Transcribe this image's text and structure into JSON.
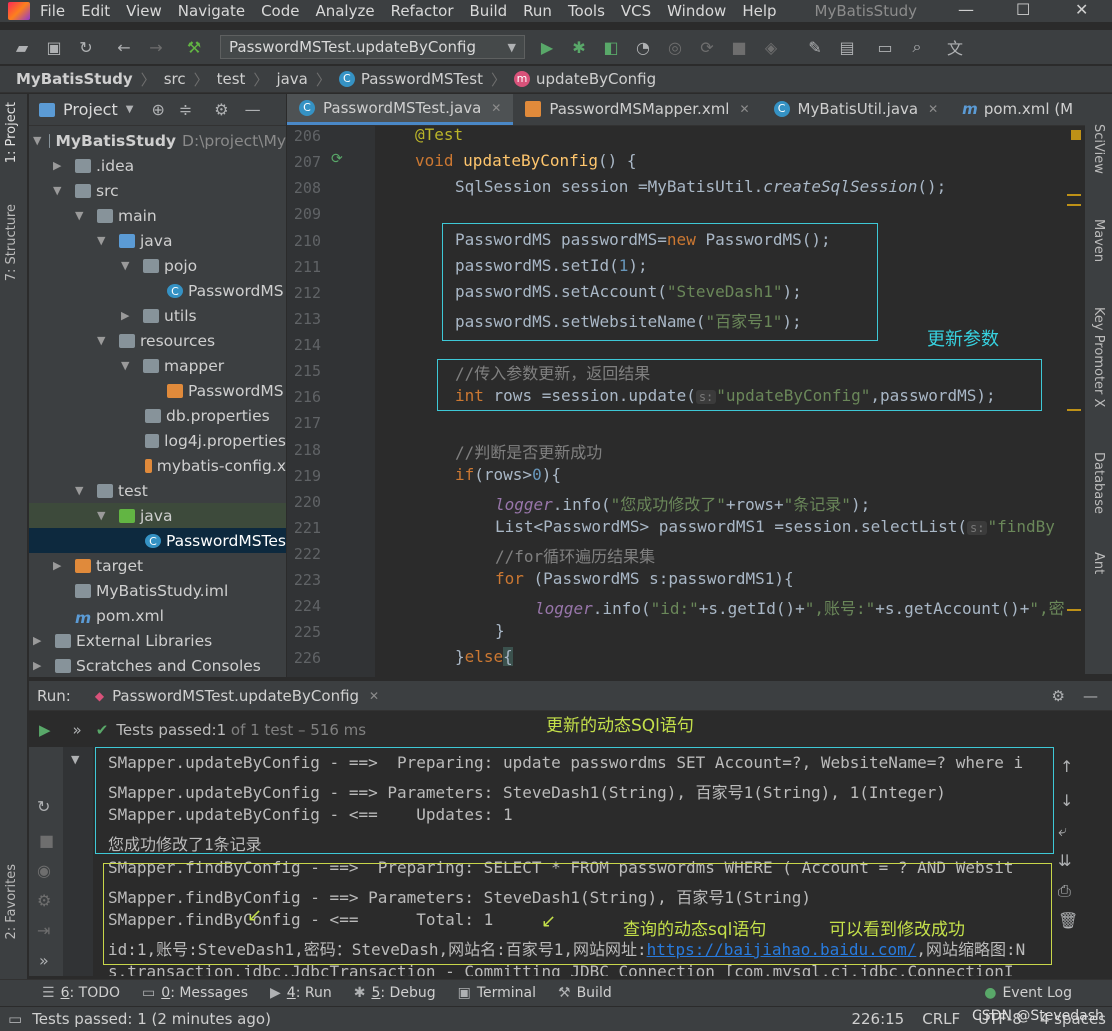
{
  "menubar": {
    "items": [
      "File",
      "Edit",
      "View",
      "Navigate",
      "Code",
      "Analyze",
      "Refactor",
      "Build",
      "Run",
      "Tools",
      "VCS",
      "Window",
      "Help"
    ],
    "title": "MyBatisStudy",
    "minimize": "—",
    "maximize": "☐",
    "close": "✕"
  },
  "toolbar": {
    "run_config": "PasswordMSTest.updateByConfig"
  },
  "breadcrumb": [
    "MyBatisStudy",
    "src",
    "test",
    "java",
    "PasswordMSTest",
    "updateByConfig"
  ],
  "project": {
    "header": "Project",
    "items": [
      {
        "label": "MyBatisStudy",
        "extra": "D:\\project\\My"
      },
      {
        "label": ".idea"
      },
      {
        "label": "src"
      },
      {
        "label": "main"
      },
      {
        "label": "java"
      },
      {
        "label": "pojo"
      },
      {
        "label": "PasswordMS"
      },
      {
        "label": "utils"
      },
      {
        "label": "resources"
      },
      {
        "label": "mapper"
      },
      {
        "label": "PasswordMS"
      },
      {
        "label": "db.properties"
      },
      {
        "label": "log4j.properties"
      },
      {
        "label": "mybatis-config.x"
      },
      {
        "label": "test"
      },
      {
        "label": "java"
      },
      {
        "label": "PasswordMSTes"
      },
      {
        "label": "target"
      },
      {
        "label": "MyBatisStudy.iml"
      },
      {
        "label": "pom.xml"
      },
      {
        "label": "External Libraries"
      },
      {
        "label": "Scratches and Consoles"
      }
    ]
  },
  "tabs": [
    "PasswordMSTest.java",
    "PasswordMSMapper.xml",
    "MyBatisUtil.java",
    "pom.xml (M"
  ],
  "left_strip": [
    "1: Project",
    "7: Structure",
    "2: Favorites"
  ],
  "right_strip": [
    "SciView",
    "Maven",
    "Key Promoter X",
    "Database",
    "Ant"
  ],
  "editor": {
    "line_numbers": [
      "206",
      "207",
      "208",
      "209",
      "210",
      "211",
      "212",
      "213",
      "214",
      "215",
      "216",
      "217",
      "218",
      "219",
      "220",
      "221",
      "222",
      "223",
      "224",
      "225",
      "226"
    ],
    "l206": "@Test",
    "l207_kw": "void ",
    "l207_fn": "updateByConfig",
    "l207_rest": "() {",
    "l208_a": "SqlSession session =MyBatisUtil.",
    "l208_b": "createSqlSession",
    "l208_c": "();",
    "l210_a": "PasswordMS passwordMS=",
    "l210_kw": "new",
    "l210_b": " PasswordMS();",
    "l211_a": "passwordMS.setId(",
    "l211_n": "1",
    "l211_b": ");",
    "l212_a": "passwordMS.setAccount(",
    "l212_s": "\"SteveDash1\"",
    "l212_b": ");",
    "l213_a": "passwordMS.setWebsiteName(",
    "l213_s": "\"百家号1\"",
    "l213_b": ");",
    "l215": "//传入参数更新，返回结果",
    "l216_kw": "int",
    "l216_a": " rows =session.update(",
    "l216_hint": "s:",
    "l216_s": "\"updateByConfig\"",
    "l216_b": ",passwordMS);",
    "l218": "//判断是否更新成功",
    "l219_kw": "if",
    "l219_a": "(rows>",
    "l219_n": "0",
    "l219_b": "){",
    "l220_a": "logger",
    "l220_b": ".info(",
    "l220_s": "\"您成功修改了\"",
    "l220_c": "+rows+",
    "l220_s2": "\"条记录\"",
    "l220_d": ");",
    "l221_a": "List<PasswordMS> passwordMS1 =session.selectList(",
    "l221_hint": "s:",
    "l221_s": "\"findBy",
    "l222": "//for循环遍历结果集",
    "l223_kw": "for",
    "l223_a": " (PasswordMS s:passwordMS1){",
    "l224_a": "logger",
    "l224_b": ".info(",
    "l224_s": "\"id:\"",
    "l224_c": "+s.getId()+",
    "l224_s2": "\",账号:\"",
    "l224_d": "+s.getAccount()+",
    "l224_s3": "\",密",
    "l225": "}",
    "l226_a": "}",
    "l226_kw": "else",
    "l226_b": "{"
  },
  "annotations": {
    "update_params": "更新参数",
    "updated_sql": "更新的动态SQl语句",
    "query_sql": "查询的动态sql语句",
    "success": "可以看到修改成功"
  },
  "run": {
    "label": "Run:",
    "tab": "PasswordMSTest.updateByConfig",
    "tests_passed_a": "Tests passed: ",
    "tests_passed_b": "1",
    "tests_passed_c": " of 1 test – 516 ms",
    "lines": [
      "SMapper.updateByConfig - ==>  Preparing: update passwordms SET Account=?, WebsiteName=? where i",
      "SMapper.updateByConfig - ==> Parameters: SteveDash1(String), 百家号1(String), 1(Integer)",
      "SMapper.updateByConfig - <==    Updates: 1",
      "您成功修改了1条记录",
      "SMapper.findByConfig - ==>  Preparing: SELECT * FROM passwordms WHERE ( Account = ? AND Websit",
      "SMapper.findByConfig - ==> Parameters: SteveDash1(String), 百家号1(String)",
      "SMapper.findByConfig - <==      Total: 1",
      "s.transaction.jdbc.JdbcTransaction - Committing JDBC Connection [com.mysql.cj.jdbc.ConnectionI"
    ],
    "result_a": "id:1,账号:SteveDash1,密码：SteveDash,网站名:百家号1,网站网址:",
    "result_link": "https://baijiahao.baidu.com/",
    "result_b": ",网站缩略图:N"
  },
  "bottom_tabs": [
    {
      "num": "6",
      "label": ": TODO"
    },
    {
      "num": "0",
      "label": ": Messages"
    },
    {
      "num": "4",
      "label": ": Run"
    },
    {
      "num": "5",
      "label": ": Debug"
    },
    {
      "num": "",
      "label": "Terminal"
    },
    {
      "num": "",
      "label": "Build"
    }
  ],
  "event_log": "Event Log",
  "status": {
    "message": "Tests passed: 1 (2 minutes ago)",
    "position": "226:15",
    "line_sep": "CRLF",
    "encoding": "UTF-8",
    "indent": "4 spaces",
    "watermark": "CSDN @Stevedash"
  }
}
